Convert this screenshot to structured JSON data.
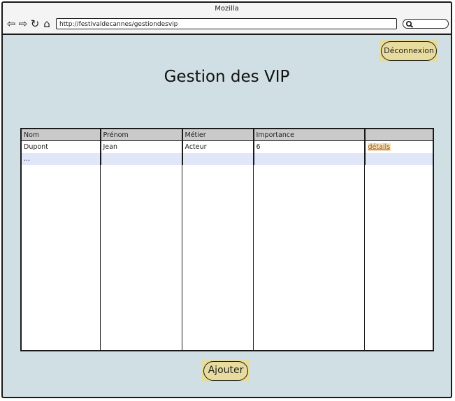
{
  "browser": {
    "title": "Mozilla",
    "url": "http://festivaldecannes/gestiondesvip"
  },
  "header": {
    "logout_label": "Déconnexion",
    "title": "Gestion des VIP"
  },
  "table": {
    "columns": [
      "Nom",
      "Prénom",
      "Métier",
      "Importance",
      ""
    ],
    "rows": [
      {
        "nom": "Dupont",
        "prenom": "Jean",
        "metier": "Acteur",
        "importance": "6",
        "action": "détails"
      },
      {
        "nom": "...",
        "prenom": "",
        "metier": "",
        "importance": "",
        "action": ""
      }
    ]
  },
  "footer": {
    "add_label": "Ajouter"
  },
  "colors": {
    "background": "#cfdfe3",
    "button": "#e7dc9d",
    "header_row": "#cacaca",
    "selected_row": "#dfe7f8",
    "link": "#b04b1f"
  }
}
